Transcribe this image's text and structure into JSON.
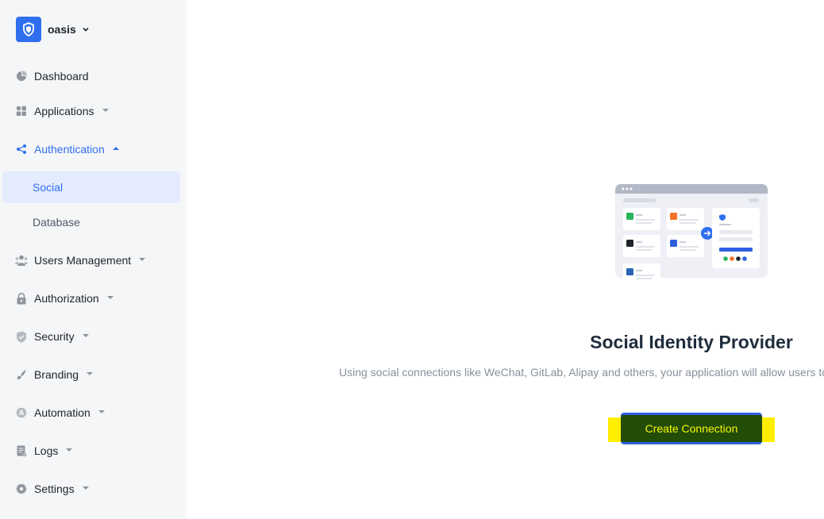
{
  "org": {
    "name": "oasis"
  },
  "nav": {
    "dashboard": "Dashboard",
    "applications": "Applications",
    "authentication": "Authentication",
    "social": "Social",
    "database": "Database",
    "users_management": "Users Management",
    "authorization": "Authorization",
    "security": "Security",
    "branding": "Branding",
    "automation": "Automation",
    "logs": "Logs",
    "settings": "Settings"
  },
  "main": {
    "title": "Social Identity Provider",
    "description": "Using social connections like WeChat, GitLab, Alipay and others, your application will allow users to",
    "create_button": "Create Connection"
  },
  "colors": {
    "accent": "#2f6fef",
    "sidebar_bg": "#f5f6f7",
    "selected_bg": "#e4ebfd",
    "cta_bg": "#234c08",
    "cta_text": "#f7f700",
    "highlight": "#ffee00"
  }
}
